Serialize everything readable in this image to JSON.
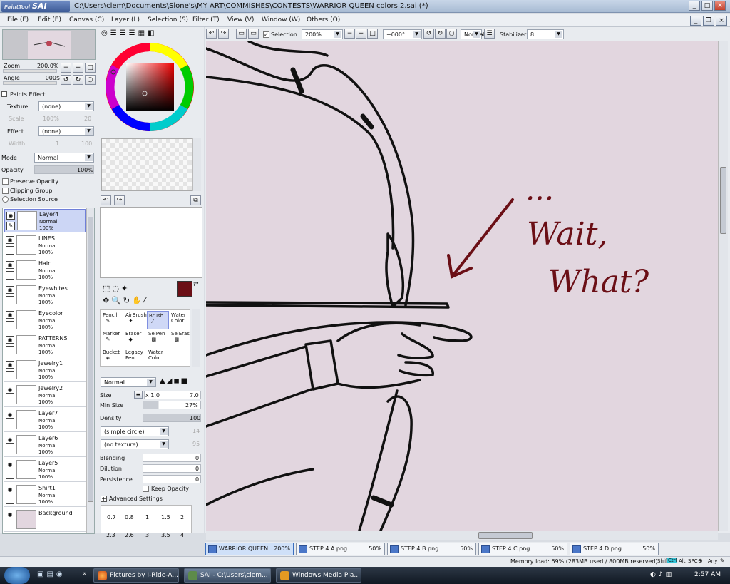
{
  "window": {
    "app": "SAI",
    "app_prefix": "PaintTool",
    "title": "C:\\Users\\clem\\Documents\\Slone's\\MY ART\\COMMISHES\\CONTESTS\\WARRIOR QUEEN colors 2.sai (*)"
  },
  "menu": [
    "File (F)",
    "Edit (E)",
    "Canvas (C)",
    "Layer (L)",
    "Selection (S)",
    "Filter (T)",
    "View (V)",
    "Window (W)",
    "Others (O)"
  ],
  "navigator": {
    "zoom_label": "Zoom",
    "zoom_value": "200.0%",
    "angle_label": "Angle",
    "angle_value": "+000$"
  },
  "paints_effect": {
    "header": "Paints Effect",
    "texture_label": "Texture",
    "texture_value": "(none)",
    "scale_label": "Scale",
    "scale_value": "100%",
    "scale_num": "20",
    "effect_label": "Effect",
    "effect_value": "(none)",
    "width_label": "Width",
    "width_value": "1",
    "width_num": "100"
  },
  "layer_props": {
    "mode_label": "Mode",
    "mode_value": "Normal",
    "opacity_label": "Opacity",
    "opacity_value": "100%",
    "preserve_opacity": "Preserve Opacity",
    "clipping_group": "Clipping Group",
    "selection_source": "Selection Source"
  },
  "layers": [
    {
      "name": "Layer4",
      "mode": "Normal",
      "opacity": "100%",
      "selected": true
    },
    {
      "name": "LINES",
      "mode": "Normal",
      "opacity": "100%"
    },
    {
      "name": "Hair",
      "mode": "Normal",
      "opacity": "100%"
    },
    {
      "name": "Eyewhites",
      "mode": "Normal",
      "opacity": "100%"
    },
    {
      "name": "Eyecolor",
      "mode": "Normal",
      "opacity": "100%"
    },
    {
      "name": "PATTERNS",
      "mode": "Normal",
      "opacity": "100%"
    },
    {
      "name": "Jewelry1",
      "mode": "Normal",
      "opacity": "100%"
    },
    {
      "name": "Jewelry2",
      "mode": "Normal",
      "opacity": "100%"
    },
    {
      "name": "Layer7",
      "mode": "Normal",
      "opacity": "100%"
    },
    {
      "name": "Layer6",
      "mode": "Normal",
      "opacity": "100%"
    },
    {
      "name": "Layer5",
      "mode": "Normal",
      "opacity": "100%"
    },
    {
      "name": "Shirt1",
      "mode": "Normal",
      "opacity": "100%"
    },
    {
      "name": "Background",
      "mode": "",
      "opacity": ""
    }
  ],
  "colors": {
    "primary": "#6b0f16",
    "secondary": "#ffffff",
    "canvas_bg": "#e2d6df",
    "accent": "#3b6fbf"
  },
  "brushes": [
    {
      "label": "Pencil"
    },
    {
      "label": "AirBrush"
    },
    {
      "label": "Brush",
      "selected": true
    },
    {
      "label": "Water Color"
    },
    {
      "label": "Marker"
    },
    {
      "label": "Eraser"
    },
    {
      "label": "SelPen"
    },
    {
      "label": "SelEras"
    },
    {
      "label": "Bucket"
    },
    {
      "label": "Legacy Pen"
    },
    {
      "label": "Water Color"
    }
  ],
  "brush_props": {
    "blend_mode": "Normal",
    "size_label": "Size",
    "size_mult": "x 1.0",
    "size_value": "7.0",
    "min_size_label": "Min Size",
    "min_size_value": "27%",
    "density_label": "Density",
    "density_value": "100",
    "shape": "(simple circle)",
    "shape_num": "14",
    "texture": "(no texture)",
    "texture_num": "95",
    "blending_label": "Blending",
    "blending_value": "0",
    "dilution_label": "Dilution",
    "dilution_value": "0",
    "persistence_label": "Persistence",
    "persistence_value": "0",
    "keep_opacity": "Keep Opacity",
    "advanced": "Advanced Settings"
  },
  "size_presets": [
    [
      "0.7",
      "0.8",
      "1",
      "1.5",
      "2"
    ],
    [
      "2.3",
      "2.6",
      "3",
      "3.5",
      "4"
    ]
  ],
  "canvas_toolbar": {
    "selection_label": "Selection",
    "zoom": "200%",
    "angle": "+000°",
    "blend": "Normal",
    "stabilizer_label": "Stabilizer",
    "stabilizer_value": "8"
  },
  "canvas_text": {
    "dots": "...",
    "line1": "Wait,",
    "line2": "What?"
  },
  "tabs": [
    {
      "name": "WARRIOR QUEEN ...",
      "pct": "200%",
      "active": true
    },
    {
      "name": "STEP 4 A.png",
      "pct": "50%"
    },
    {
      "name": "STEP 4 B.png",
      "pct": "50%"
    },
    {
      "name": "STEP 4 C.png",
      "pct": "50%"
    },
    {
      "name": "STEP 4 D.png",
      "pct": "50%"
    }
  ],
  "status": {
    "memory": "Memory load: 69% (283MB used / 800MB reserved)",
    "keys": [
      "Shift",
      "Ctrl",
      "Alt",
      "SPC",
      "Any"
    ]
  },
  "taskbar": {
    "items": [
      "Pictures by I-Ride-A...",
      "SAI - C:\\Users\\clem...",
      "Windows Media Pla..."
    ],
    "clock": "2:57 AM"
  }
}
